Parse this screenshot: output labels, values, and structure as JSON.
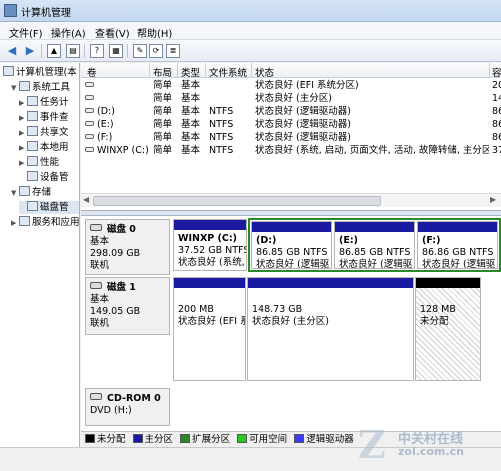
{
  "window": {
    "title": "计算机管理"
  },
  "menu": [
    "文件(F)",
    "操作(A)",
    "查看(V)",
    "帮助(H)"
  ],
  "tree": [
    {
      "label": "计算机管理(本",
      "exp": "",
      "icon": "computer-icon",
      "level": 0
    },
    {
      "label": "系统工具",
      "exp": "▼",
      "icon": "tools-icon",
      "level": 1
    },
    {
      "label": "任务计",
      "exp": "▶",
      "icon": "clock-icon",
      "level": 2
    },
    {
      "label": "事件查",
      "exp": "▶",
      "icon": "event-viewer-icon",
      "level": 2
    },
    {
      "label": "共享文",
      "exp": "▶",
      "icon": "shared-folder-icon",
      "level": 2
    },
    {
      "label": "本地用",
      "exp": "▶",
      "icon": "users-icon",
      "level": 2
    },
    {
      "label": "性能",
      "exp": "▶",
      "icon": "performance-icon",
      "level": 2
    },
    {
      "label": "设备管",
      "exp": "",
      "icon": "device-manager-icon",
      "level": 2
    },
    {
      "label": "存储",
      "exp": "▼",
      "icon": "storage-icon",
      "level": 1
    },
    {
      "label": "磁盘管",
      "exp": "",
      "icon": "disk-management-icon",
      "level": 2,
      "selected": true
    },
    {
      "label": "服务和应用",
      "exp": "▶",
      "icon": "services-icon",
      "level": 1
    }
  ],
  "volume_list": {
    "columns": [
      "卷",
      "布局",
      "类型",
      "文件系统",
      "状态",
      "容"
    ],
    "rows": [
      {
        "vol": "",
        "layout": "简单",
        "type": "基本",
        "fs": "",
        "status": "状态良好 (EFI 系统分区)",
        "cap": "20"
      },
      {
        "vol": "",
        "layout": "简单",
        "type": "基本",
        "fs": "",
        "status": "状态良好 (主分区)",
        "cap": "14"
      },
      {
        "vol": "(D:)",
        "layout": "简单",
        "type": "基本",
        "fs": "NTFS",
        "status": "状态良好 (逻辑驱动器)",
        "cap": "86"
      },
      {
        "vol": "(E:)",
        "layout": "简单",
        "type": "基本",
        "fs": "NTFS",
        "status": "状态良好 (逻辑驱动器)",
        "cap": "86"
      },
      {
        "vol": "(F:)",
        "layout": "简单",
        "type": "基本",
        "fs": "NTFS",
        "status": "状态良好 (逻辑驱动器)",
        "cap": "86"
      },
      {
        "vol": "WINXP (C:)",
        "layout": "简单",
        "type": "基本",
        "fs": "NTFS",
        "status": "状态良好 (系统, 启动, 页面文件, 活动, 故障转储, 主分区)",
        "cap": "37"
      }
    ]
  },
  "disks": {
    "disk0": {
      "name": "磁盘 0",
      "type": "基本",
      "size": "298.09 GB",
      "state": "联机",
      "c": {
        "title": "WINXP  (C:)",
        "size": "37.52 GB NTFS",
        "status": "状态良好 (系统,"
      },
      "d": {
        "title": "(D:)",
        "size": "86.85 GB NTFS",
        "status": "状态良好 (逻辑驱"
      },
      "e": {
        "title": "(E:)",
        "size": "86.85 GB NTFS",
        "status": "状态良好 (逻辑驱"
      },
      "f": {
        "title": "(F:)",
        "size": "86.86 GB NTFS",
        "status": "状态良好 (逻辑驱"
      }
    },
    "disk1": {
      "name": "磁盘 1",
      "type": "基本",
      "size": "149.05 GB",
      "state": "联机",
      "p1": {
        "size": "200 MB",
        "status": "状态良好 (EFI 系"
      },
      "p2": {
        "size": "148.73 GB",
        "status": "状态良好 (主分区)"
      },
      "p3": {
        "size": "128 MB",
        "status": "未分配"
      }
    },
    "cdrom": {
      "name": "CD-ROM 0",
      "type": "DVD (H:)"
    }
  },
  "legend": [
    {
      "label": "未分配",
      "color": "#000000"
    },
    {
      "label": "主分区",
      "color": "#1a1aa0"
    },
    {
      "label": "扩展分区",
      "color": "#2a8a2a"
    },
    {
      "label": "可用空间",
      "color": "#22cc22"
    },
    {
      "label": "逻辑驱动器",
      "color": "#3a3aff"
    }
  ],
  "watermark": {
    "cn": "中关村在线",
    "url": "zol.com.cn"
  }
}
